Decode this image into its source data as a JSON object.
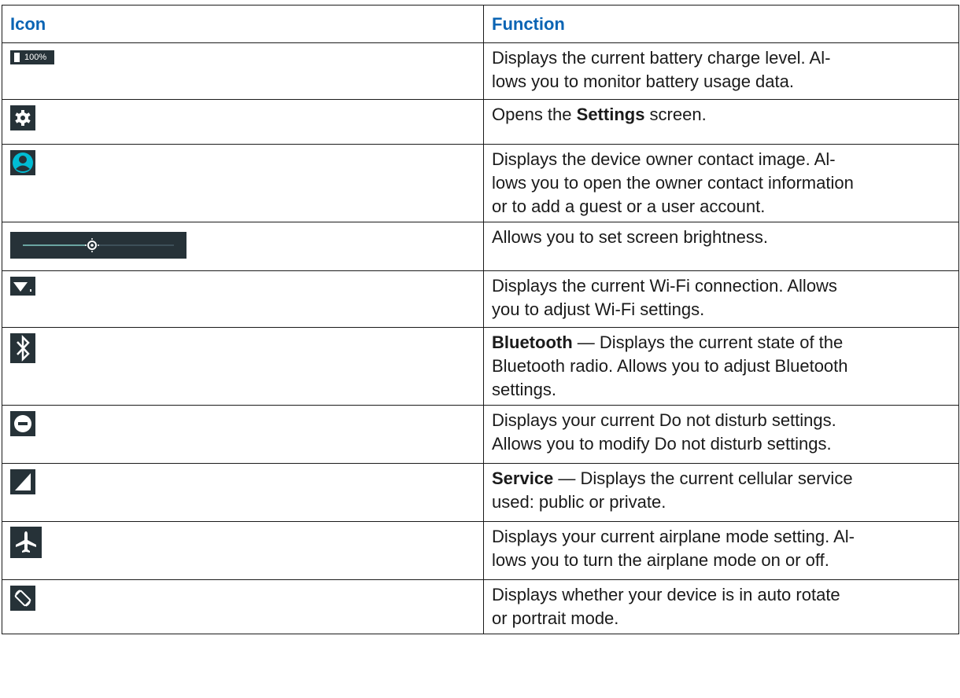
{
  "table": {
    "headers": {
      "icon": "Icon",
      "function": "Function"
    },
    "rows": [
      {
        "icon": "battery-icon",
        "battery_text": "100%",
        "lead": "",
        "sep": "",
        "text": "Displays the current battery charge level. Al-\nlows you to monitor battery usage data."
      },
      {
        "icon": "settings-gear-icon",
        "pre": "Opens the ",
        "bold": "Settings",
        "post": " screen."
      },
      {
        "icon": "owner-contact-icon",
        "text": "Displays the device owner contact image. Al-\nlows you to open the owner contact information\nor to add a guest or a user account."
      },
      {
        "icon": "brightness-slider-icon",
        "text": "Allows you to set screen brightness."
      },
      {
        "icon": "wifi-icon",
        "text": "Displays the current Wi-Fi connection. Allows\nyou to adjust Wi-Fi settings."
      },
      {
        "icon": "bluetooth-icon",
        "lead": "Bluetooth",
        "sep": " — ",
        "text": "Displays the current state of the\nBluetooth radio. Allows you to adjust Bluetooth\nsettings."
      },
      {
        "icon": "do-not-disturb-icon",
        "text": "Displays your current Do not disturb settings.\nAllows you to modify Do not disturb settings."
      },
      {
        "icon": "cellular-signal-icon",
        "lead": "Service",
        "sep": " — ",
        "text": "Displays the current cellular service\nused: public or private."
      },
      {
        "icon": "airplane-icon",
        "text": "Displays your current airplane mode setting. Al-\nlows you to turn the airplane mode on or off."
      },
      {
        "icon": "auto-rotate-icon",
        "text": "Displays whether your device is in auto rotate\nor portrait mode."
      }
    ]
  },
  "colors": {
    "header_text": "#0a64b4",
    "icon_bg": "#263238",
    "contact_accent": "#00bcd4"
  }
}
